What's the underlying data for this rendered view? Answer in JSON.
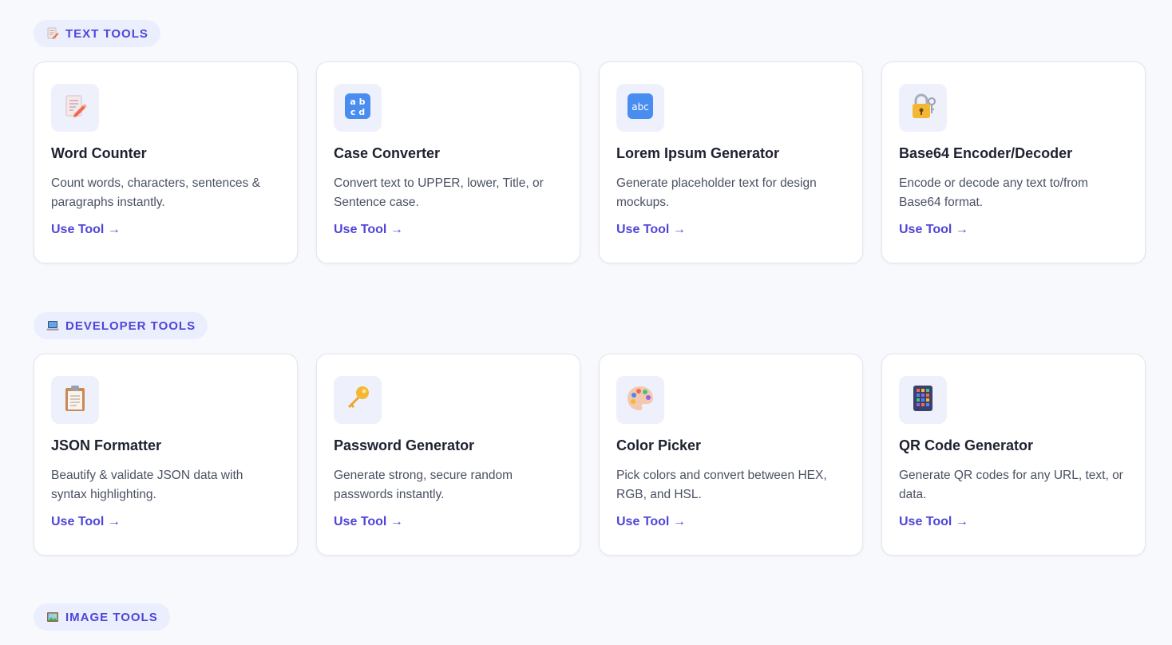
{
  "sections": [
    {
      "badge_icon": "memo-icon",
      "label": "TEXT TOOLS",
      "tools": [
        {
          "icon": "memo-icon",
          "title": "Word Counter",
          "desc": "Count words, characters, sentences & paragraphs instantly.",
          "link": "Use Tool →"
        },
        {
          "icon": "abcd-icon",
          "title": "Case Converter",
          "desc": "Convert text to UPPER, lower, Title, or Sentence case.",
          "link": "Use Tool →"
        },
        {
          "icon": "abc-icon",
          "title": "Lorem Ipsum Generator",
          "desc": "Generate placeholder text for design mockups.",
          "link": "Use Tool →"
        },
        {
          "icon": "lock-key-icon",
          "title": "Base64 Encoder/Decoder",
          "desc": "Encode or decode any text to/from Base64 format.",
          "link": "Use Tool →"
        }
      ]
    },
    {
      "badge_icon": "laptop-icon",
      "label": "DEVELOPER TOOLS",
      "tools": [
        {
          "icon": "clipboard-icon",
          "title": "JSON Formatter",
          "desc": "Beautify & validate JSON data with syntax highlighting.",
          "link": "Use Tool →"
        },
        {
          "icon": "key-icon",
          "title": "Password Generator",
          "desc": "Generate strong, secure random passwords instantly.",
          "link": "Use Tool →"
        },
        {
          "icon": "palette-icon",
          "title": "Color Picker",
          "desc": "Pick colors and convert between HEX, RGB, and HSL.",
          "link": "Use Tool →"
        },
        {
          "icon": "abacus-icon",
          "title": "QR Code Generator",
          "desc": "Generate QR codes for any URL, text, or data.",
          "link": "Use Tool →"
        }
      ]
    },
    {
      "badge_icon": "picture-icon",
      "label": "IMAGE TOOLS",
      "tools": []
    }
  ],
  "colors": {
    "accent": "#4f46d8",
    "badge_bg": "#ebeefd",
    "icon_tile_bg": "#eef0fc",
    "page_bg": "#f8f9fc"
  }
}
